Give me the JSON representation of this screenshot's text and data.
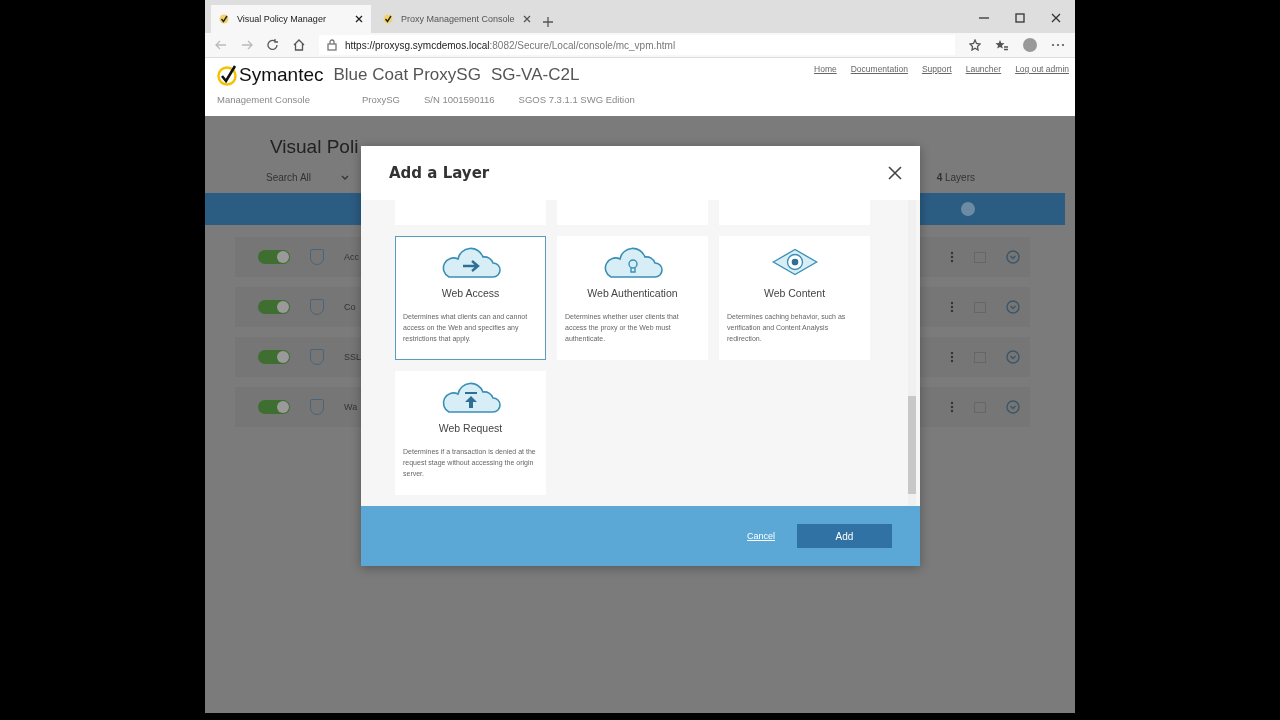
{
  "browser": {
    "tabs": [
      {
        "label": "Visual Policy Manager",
        "selected": true
      },
      {
        "label": "Proxy Management Console",
        "selected": false
      }
    ],
    "url": {
      "host": "https://proxysg.symcdemos.local",
      "rest": ":8082/Secure/Local/console/mc_vpm.html"
    }
  },
  "header": {
    "brand": "Symantec",
    "product": "Blue Coat ProxySG",
    "model": "SG-VA-C2L",
    "console": "Management Console",
    "device": "ProxySG",
    "serial": "S/N 1001590116",
    "version": "SGOS 7.3.1.1 SWG Edition",
    "links": [
      "Home",
      "Documentation",
      "Support",
      "Launcher",
      "Log out admin"
    ]
  },
  "page": {
    "title": "Visual Poli",
    "search": "Search All",
    "layer_count": "**4** Layers",
    "rows": [
      {
        "name": "Acc",
        "on": true
      },
      {
        "name": "Co",
        "on": true
      },
      {
        "name": "SSL",
        "on": true
      },
      {
        "name": "Wa",
        "on": true
      }
    ]
  },
  "dialog": {
    "title": "Add a Layer",
    "cards": [
      {
        "kind": "access",
        "title": "Web Access",
        "description": "Determines what clients can and cannot access on the Web and specifies any restrictions that apply.",
        "selected": true
      },
      {
        "kind": "auth",
        "title": "Web Authentication",
        "description": "Determines whether user clients that access the proxy or the Web must authenticate.",
        "selected": false
      },
      {
        "kind": "content",
        "title": "Web Content",
        "description": "Determines caching behavior, such as verification and Content Analysis redirection.",
        "selected": false
      },
      {
        "kind": "request",
        "title": "Web Request",
        "description": "Determines if a transaction is denied at the request stage without accessing the origin server.",
        "selected": false
      }
    ],
    "cancel": "Cancel",
    "add": "Add"
  }
}
